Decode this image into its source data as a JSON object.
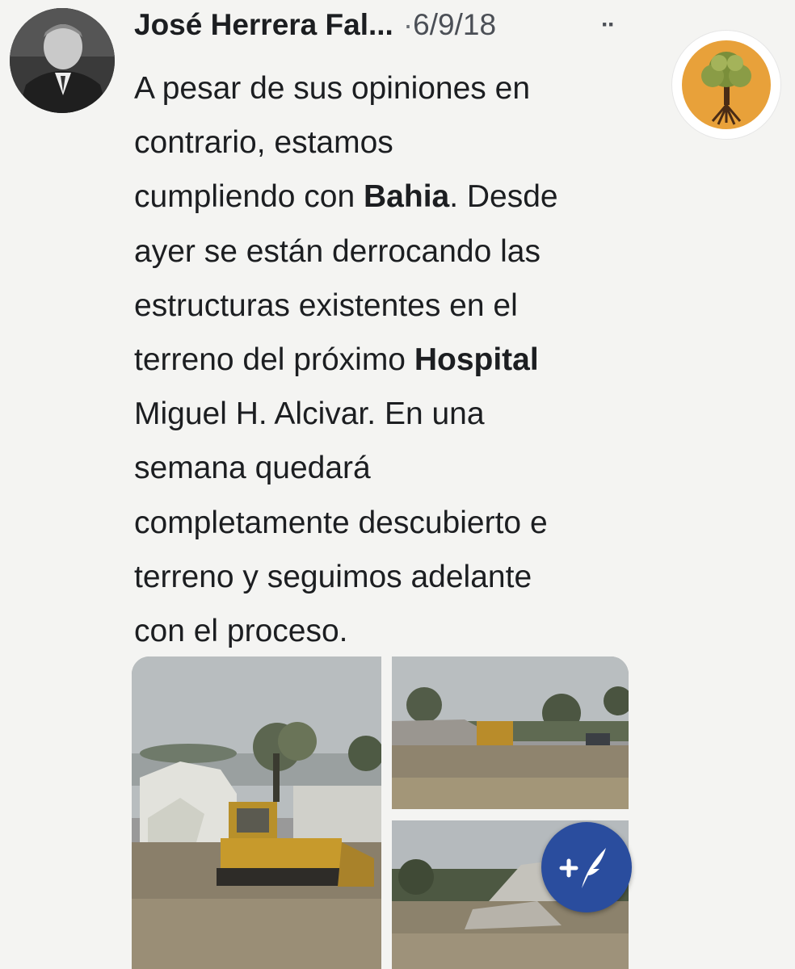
{
  "post": {
    "author": "José Herrera Fal...",
    "separator": "·",
    "date": "6/9/18",
    "more_label": "··",
    "message_lines": [
      {
        "pre": "A pesar de sus opiniones en",
        "bold": "",
        "post": ""
      },
      {
        "pre": "contrario, estamos",
        "bold": "",
        "post": ""
      },
      {
        "pre": "cumpliendo con ",
        "bold": "Bahia",
        "post": ". Desde"
      },
      {
        "pre": "ayer se están derrocando las",
        "bold": "",
        "post": ""
      },
      {
        "pre": "estructuras existentes en el",
        "bold": "",
        "post": ""
      },
      {
        "pre": "terreno del próximo ",
        "bold": "Hospital",
        "post": ""
      },
      {
        "pre": "Miguel H. Alcivar.  En una",
        "bold": "",
        "post": ""
      },
      {
        "pre": "semana quedará",
        "bold": "",
        "post": ""
      },
      {
        "pre": "completamente descubierto e",
        "bold": "",
        "post": ""
      },
      {
        "pre": "terreno y seguimos adelante",
        "bold": "",
        "post": ""
      },
      {
        "pre": "con el proceso.",
        "bold": "",
        "post": ""
      }
    ]
  },
  "icons": {
    "avatar": "profile-photo",
    "page_logo": "tree-logo",
    "fab": "plus-quill-icon"
  },
  "colors": {
    "text": "#1c1e21",
    "muted": "#4b4f56",
    "fab": "#2a4d9e",
    "logo_bg": "#e8a13a"
  }
}
